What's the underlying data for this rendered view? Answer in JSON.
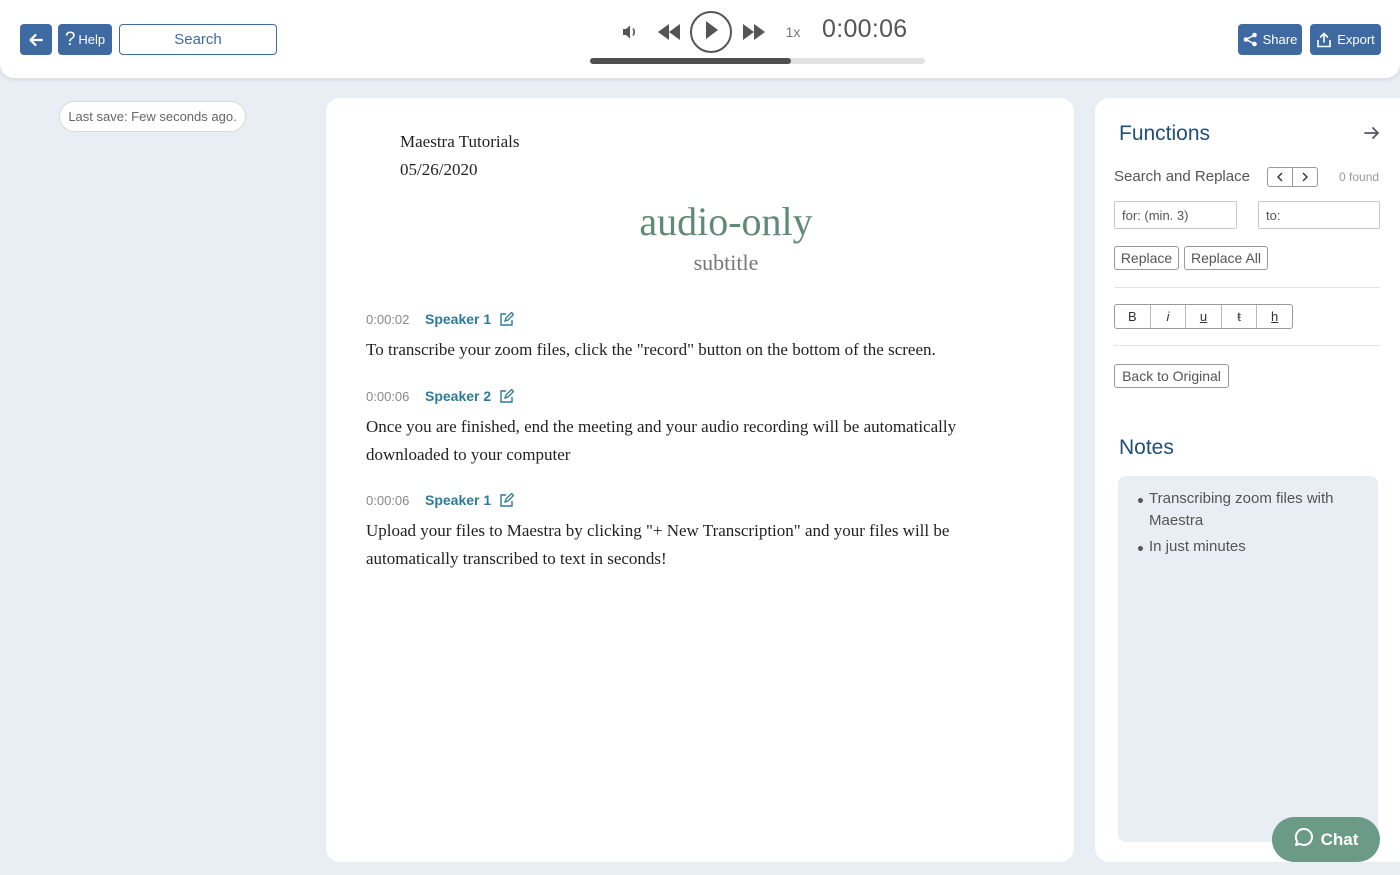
{
  "toolbar": {
    "back_icon": "arrow-left-icon",
    "help_label": "Help",
    "help_icon": "question-icon",
    "search_label": "Search",
    "share_label": "Share",
    "export_label": "Export"
  },
  "player": {
    "speed": "1x",
    "time": "0:00:06",
    "progress_fraction": 0.6,
    "icons": [
      "volume-icon",
      "rewind-icon",
      "play-icon",
      "fast-forward-icon"
    ]
  },
  "status": {
    "last_save": "Last save: Few seconds ago."
  },
  "document": {
    "header_line1": "Maestra Tutorials",
    "header_line2": "05/26/2020",
    "title": "audio-only",
    "subtitle": "subtitle",
    "segments": [
      {
        "time": "0:00:02",
        "speaker": "Speaker 1",
        "text": "To transcribe your zoom files, click the \"record\" button on the bottom of the screen."
      },
      {
        "time": "0:00:06",
        "speaker": "Speaker 2",
        "text": "Once you are finished, end the meeting and your audio recording will be automatically downloaded to your computer"
      },
      {
        "time": "0:00:06",
        "speaker": "Speaker 1",
        "text": "Upload your files to Maestra by clicking \"+ New Transcription\" and your files will be automatically transcribed to text in seconds!"
      }
    ]
  },
  "functions": {
    "title": "Functions",
    "search_replace_label": "Search and Replace",
    "found": "0 found",
    "for_placeholder": "for: (min. 3)",
    "to_placeholder": "to:",
    "replace_label": "Replace",
    "replace_all_label": "Replace All",
    "format_buttons": [
      "B",
      "i",
      "u",
      "ŧ",
      "h"
    ],
    "back_original_label": "Back to Original"
  },
  "notes": {
    "title": "Notes",
    "items": [
      "Transcribing zoom files with Maestra",
      "In just minutes"
    ]
  },
  "chat": {
    "label": "Chat"
  },
  "colors": {
    "primary": "#3f6aa1",
    "heading": "#1f4e79",
    "title_green": "#5f8a78",
    "speaker": "#2e7a9b",
    "chat": "#6b9a86"
  }
}
